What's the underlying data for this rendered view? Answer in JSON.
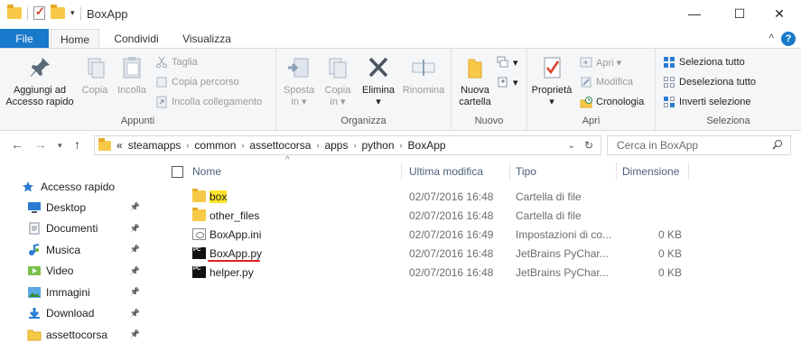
{
  "window": {
    "title": "BoxApp",
    "minimize": "—",
    "maximize": "☐",
    "close": "✕"
  },
  "tabs": {
    "file": "File",
    "home": "Home",
    "share": "Condividi",
    "view": "Visualizza",
    "collapse": "^",
    "help": "?"
  },
  "ribbon": {
    "appunti": {
      "label": "Appunti",
      "pin": [
        "Aggiungi ad",
        "Accesso rapido"
      ],
      "copy": "Copia",
      "paste": "Incolla",
      "cut": "Taglia",
      "copy_path": "Copia percorso",
      "paste_shortcut": "Incolla collegamento"
    },
    "organizza": {
      "label": "Organizza",
      "move": [
        "Sposta",
        "in ▾"
      ],
      "copy_to": [
        "Copia",
        "in ▾"
      ],
      "delete": [
        "Elimina",
        "▾"
      ],
      "rename": "Rinomina"
    },
    "nuovo": {
      "label": "Nuovo",
      "new_folder": [
        "Nuova",
        "cartella"
      ]
    },
    "apri": {
      "label": "Apri",
      "properties": [
        "Proprietà",
        "▾"
      ],
      "open": "Apri ▾",
      "edit": "Modifica",
      "history": "Cronologia"
    },
    "seleziona": {
      "label": "Seleziona",
      "select_all": "Seleziona tutto",
      "select_none": "Deseleziona tutto",
      "invert": "Inverti selezione"
    }
  },
  "address": {
    "chevron": "«",
    "crumbs": [
      "steamapps",
      "common",
      "assettocorsa",
      "apps",
      "python",
      "BoxApp"
    ],
    "search_placeholder": "Cerca in BoxApp"
  },
  "nav": {
    "quick_access": "Accesso rapido",
    "items": [
      {
        "label": "Desktop",
        "icon": "desktop-icon"
      },
      {
        "label": "Documenti",
        "icon": "documents-icon"
      },
      {
        "label": "Musica",
        "icon": "music-icon"
      },
      {
        "label": "Video",
        "icon": "video-icon"
      },
      {
        "label": "Immagini",
        "icon": "pictures-icon"
      },
      {
        "label": "Download",
        "icon": "download-icon"
      },
      {
        "label": "assettocorsa",
        "icon": "folder-icon"
      }
    ]
  },
  "columns": {
    "name": "Nome",
    "modified": "Ultima modifica",
    "type": "Tipo",
    "size": "Dimensione"
  },
  "files": [
    {
      "name": "box",
      "modified": "02/07/2016 16:48",
      "type": "Cartella di file",
      "size": "",
      "kind": "folder",
      "highlight": true
    },
    {
      "name": "other_files",
      "modified": "02/07/2016 16:48",
      "type": "Cartella di file",
      "size": "",
      "kind": "folder"
    },
    {
      "name": "BoxApp.ini",
      "modified": "02/07/2016 16:49",
      "type": "Impostazioni di co...",
      "size": "0 KB",
      "kind": "ini"
    },
    {
      "name": "BoxApp.py",
      "modified": "02/07/2016 16:48",
      "type": "JetBrains PyChar...",
      "size": "0 KB",
      "kind": "py",
      "underline": true
    },
    {
      "name": "helper.py",
      "modified": "02/07/2016 16:48",
      "type": "JetBrains PyChar...",
      "size": "0 KB",
      "kind": "py"
    }
  ],
  "colors": {
    "accent": "#1979ca",
    "highlight": "#ffe32a",
    "underline": "#e02020"
  }
}
